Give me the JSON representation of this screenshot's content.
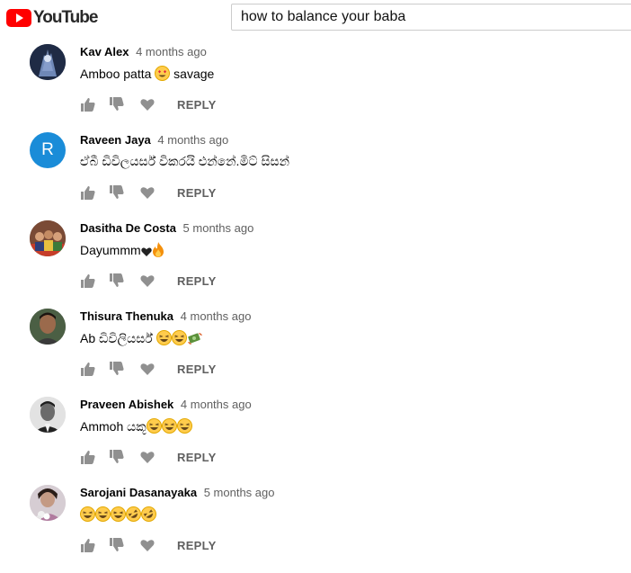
{
  "brand": {
    "name": "YouTube",
    "logo_color": "#ff0000"
  },
  "search": {
    "value": "how to balance your baba"
  },
  "actions": {
    "reply_label": "REPLY"
  },
  "comments": [
    {
      "author": "Kav Alex",
      "published": "4 months ago",
      "text": "Amboo patta",
      "emojis": [
        "heart-eyes"
      ],
      "text_after": " savage"
    },
    {
      "author": "Raveen Jaya",
      "published": "4 months ago",
      "text": "ඒබී ඩිවිලයර්ස් විකරයි එන්නේ.මිට් සිසන්",
      "avatar_letter": "R",
      "avatar_color": "#1a8cd8"
    },
    {
      "author": "Dasitha De Costa",
      "published": "5 months ago",
      "text": "Dayummm",
      "emojis": [
        "black-heart",
        "fire"
      ]
    },
    {
      "author": "Thisura Thenuka",
      "published": "4 months ago",
      "text": "Ab ඩිවිලියර්ස් ",
      "emojis": [
        "laugh",
        "laugh",
        "money"
      ]
    },
    {
      "author": "Praveen Abishek",
      "published": "4 months ago",
      "text": "Ammoh යකූ",
      "emojis": [
        "laugh",
        "laugh",
        "laugh"
      ]
    },
    {
      "author": "Sarojani Dasanayaka",
      "published": "5 months ago",
      "text": "",
      "emojis": [
        "laugh",
        "laugh",
        "laugh",
        "rofl",
        "rofl"
      ]
    }
  ]
}
